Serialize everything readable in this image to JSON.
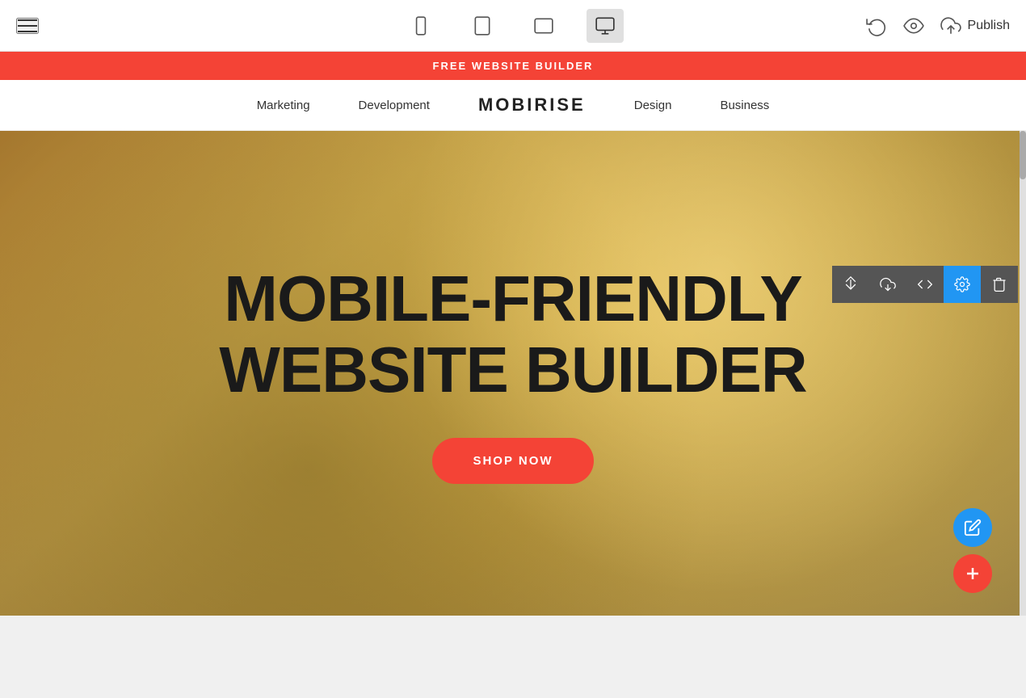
{
  "toolbar": {
    "hamburger_label": "menu",
    "devices": [
      {
        "id": "mobile",
        "label": "Mobile view"
      },
      {
        "id": "tablet",
        "label": "Tablet view"
      },
      {
        "id": "tablet-landscape",
        "label": "Tablet landscape view"
      },
      {
        "id": "desktop",
        "label": "Desktop view",
        "active": true
      }
    ],
    "undo_label": "Undo",
    "preview_label": "Preview",
    "publish_label": "Publish"
  },
  "banner": {
    "text": "FREE WEBSITE BUILDER"
  },
  "nav": {
    "links": [
      {
        "label": "Marketing"
      },
      {
        "label": "Development"
      },
      {
        "label": "Design"
      },
      {
        "label": "Business"
      }
    ],
    "logo": "MOBIRISE"
  },
  "hero": {
    "title_line1": "MOBILE-FRIENDLY",
    "title_line2": "WEBSITE BUILDER",
    "cta_label": "SHOP NOW"
  },
  "section_tools": [
    {
      "id": "reorder",
      "label": "Reorder"
    },
    {
      "id": "download",
      "label": "Download"
    },
    {
      "id": "code",
      "label": "Code"
    },
    {
      "id": "settings",
      "label": "Settings",
      "active": true
    },
    {
      "id": "delete",
      "label": "Delete"
    }
  ],
  "fabs": {
    "edit_label": "Edit",
    "add_label": "Add block"
  }
}
